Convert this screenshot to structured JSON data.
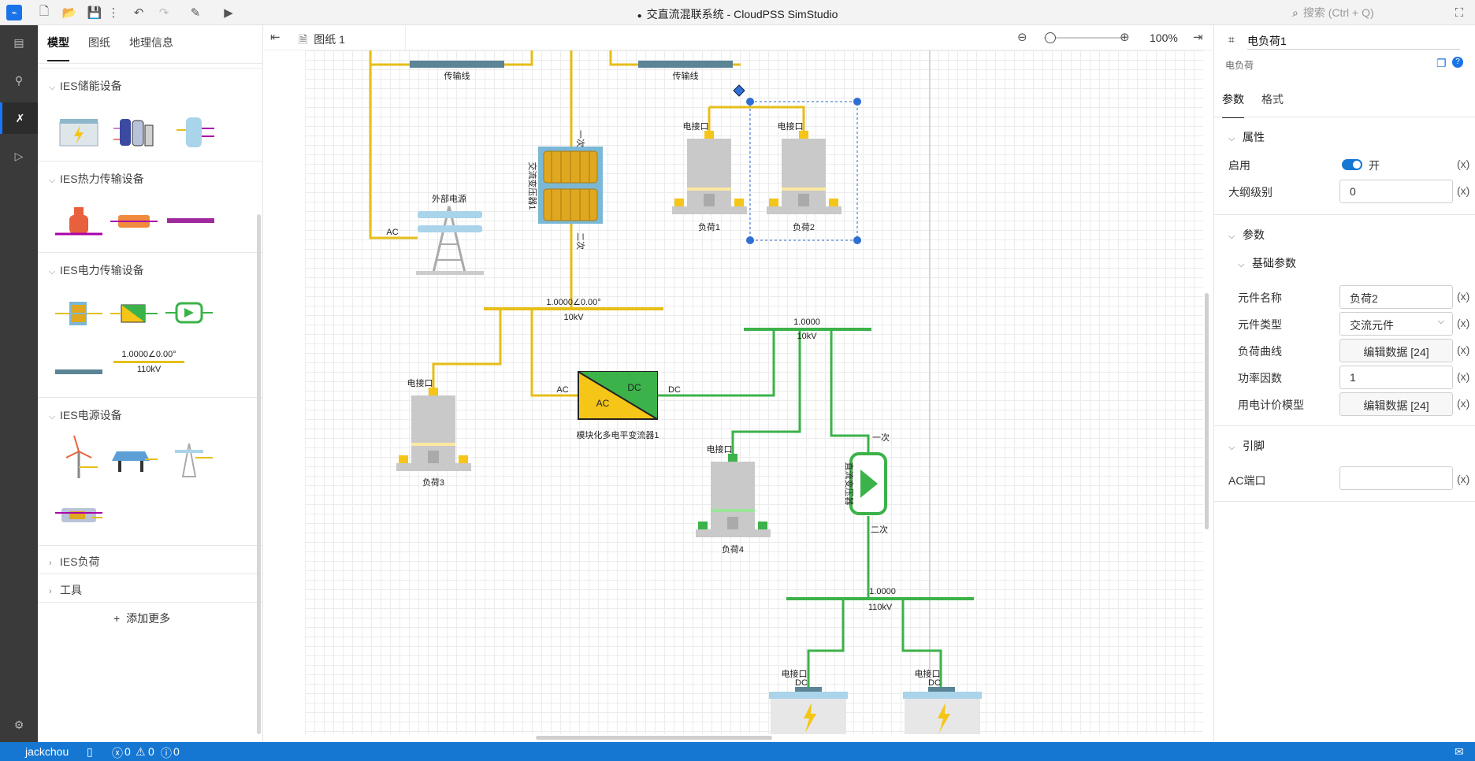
{
  "window": {
    "title": "交直流混联系统 - CloudPSS SimStudio",
    "search_placeholder": "搜索 (Ctrl + Q)"
  },
  "sidebar": {
    "tabs": [
      "模型",
      "图纸",
      "地理信息"
    ],
    "sections": {
      "storage": "IES储能设备",
      "thermal": "IES热力传输设备",
      "electric": "IES电力传输设备",
      "power": "IES电源设备",
      "load": "IES负荷",
      "tools": "工具"
    },
    "bus_thumb_label1": "1.0000∠0.00°",
    "bus_thumb_label2": "110kV",
    "add_more": "添加更多"
  },
  "editor": {
    "tab_label": "图纸 1",
    "zoom": "100%"
  },
  "diagram": {
    "line1": "传输线",
    "line2": "传输线",
    "transformer1": "交流变压器1",
    "transformer_primary": "一次",
    "transformer_secondary": "二次",
    "ext_source": "外部电源",
    "ext_port": "AC",
    "load1": "负荷1",
    "load2": "负荷2",
    "load3": "负荷3",
    "load4": "负荷4",
    "port_label": "电接口",
    "dc_port": "DC",
    "bus1_v": "1.0000∠0.00°",
    "bus1_kv": "10kV",
    "bus2_v": "1.0000",
    "bus2_kv": "10kV",
    "bus3_v": "1.0000",
    "bus3_kv": "110kV",
    "mmc_label": "模块化多电平变流器1",
    "mmc_ac": "AC",
    "mmc_dc": "DC",
    "port_ac": "AC",
    "port_dc": "DC",
    "dc_transformer": "直流变压器",
    "dc_primary": "一次",
    "dc_secondary": "二次"
  },
  "inspector": {
    "title": "电负荷1",
    "subtitle": "电负荷",
    "tabs": [
      "参数",
      "格式"
    ],
    "groups": {
      "props": "属性",
      "params": "参数",
      "basic": "基础参数",
      "pins": "引脚"
    },
    "fields": {
      "enable_label": "启用",
      "enable_value": "开",
      "outline_label": "大纲级别",
      "outline_value": "0",
      "name_label": "元件名称",
      "name_value": "负荷2",
      "type_label": "元件类型",
      "type_value": "交流元件",
      "curve_label": "负荷曲线",
      "curve_value": "编辑数据 [24]",
      "pf_label": "功率因数",
      "pf_value": "1",
      "price_label": "用电计价模型",
      "price_value": "编辑数据 [24]",
      "ac_port_label": "AC端口",
      "ac_port_value": ""
    },
    "x_marker": "(x)"
  },
  "status": {
    "user": "jackchou",
    "errors": "0",
    "warnings": "0",
    "infos": "0"
  },
  "colors": {
    "accent": "#1677d2",
    "ac_line": "#e6be18",
    "dc_line": "#3cb24a",
    "dark_bar": "#3a3a3a"
  }
}
